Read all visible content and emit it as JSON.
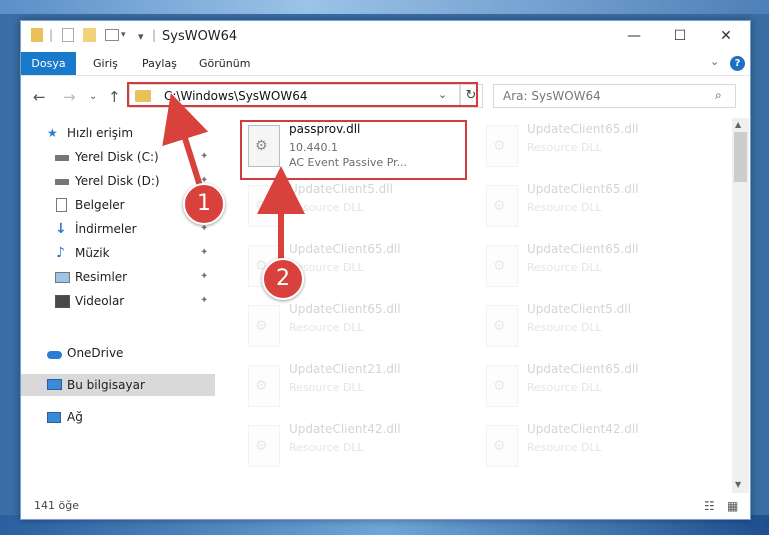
{
  "window": {
    "title": "SysWOW64",
    "qa_separator": "|",
    "qa_dropdown": "▾",
    "minimize": "—",
    "maximize": "☐",
    "close": "✕"
  },
  "ribbon": {
    "tabs": [
      "Dosya",
      "Giriş",
      "Paylaş",
      "Görünüm"
    ],
    "collapse": "⌄",
    "help": "?"
  },
  "nav": {
    "back": "←",
    "forward": "→",
    "recent": "⌄",
    "up": "↑",
    "address": "C:\\Windows\\SysWOW64",
    "address_dropdown": "⌄",
    "refresh": "↻",
    "search_placeholder": "Ara: SysWOW64",
    "search_icon": "⌕"
  },
  "sidebar": {
    "pin": "✦",
    "items": [
      {
        "label": "Hızlı erişim",
        "icon": "star-icon"
      },
      {
        "label": "Yerel Disk (C:)",
        "icon": "drive-icon"
      },
      {
        "label": "Yerel Disk (D:)",
        "icon": "drive-icon"
      },
      {
        "label": "Belgeler",
        "icon": "document-icon"
      },
      {
        "label": "İndirmeler",
        "icon": "download-icon"
      },
      {
        "label": "Müzik",
        "icon": "music-icon"
      },
      {
        "label": "Resimler",
        "icon": "pictures-icon"
      },
      {
        "label": "Videolar",
        "icon": "video-icon"
      },
      {
        "label": "OneDrive",
        "icon": "cloud-icon"
      },
      {
        "label": "Bu bilgisayar",
        "icon": "computer-icon"
      },
      {
        "label": "Ağ",
        "icon": "network-icon"
      }
    ]
  },
  "files": [
    {
      "name": "passprov.dll",
      "version": "10.440.1",
      "desc": "AC Event Passive Pr..."
    },
    {
      "name": "UpdateClient65.dll",
      "version": "Resource DLL"
    },
    {
      "name": "UpdateClient5.dll",
      "version": "Resource DLL"
    },
    {
      "name": "UpdateClient65.dll",
      "version": "Resource DLL"
    },
    {
      "name": "UpdateClient65.dll",
      "version": "Resource DLL"
    },
    {
      "name": "UpdateClient65.dll",
      "version": "Resource DLL"
    },
    {
      "name": "UpdateClient65.dll",
      "version": "Resource DLL"
    },
    {
      "name": "UpdateClient5.dll",
      "version": "Resource DLL"
    },
    {
      "name": "UpdateClient21.dll",
      "version": "Resource DLL"
    },
    {
      "name": "UpdateClient65.dll",
      "version": "Resource DLL"
    },
    {
      "name": "UpdateClient42.dll",
      "version": "Resource DLL"
    },
    {
      "name": "UpdateClient42.dll",
      "version": "Resource DLL"
    }
  ],
  "status": {
    "count": "141 öğe",
    "details_view": "☷",
    "icons_view": "▦"
  },
  "scroll": {
    "up": "▲",
    "down": "▼"
  },
  "callouts": [
    "1",
    "2"
  ],
  "colors": {
    "accent": "#1979ca",
    "highlight": "#d23c3c"
  }
}
